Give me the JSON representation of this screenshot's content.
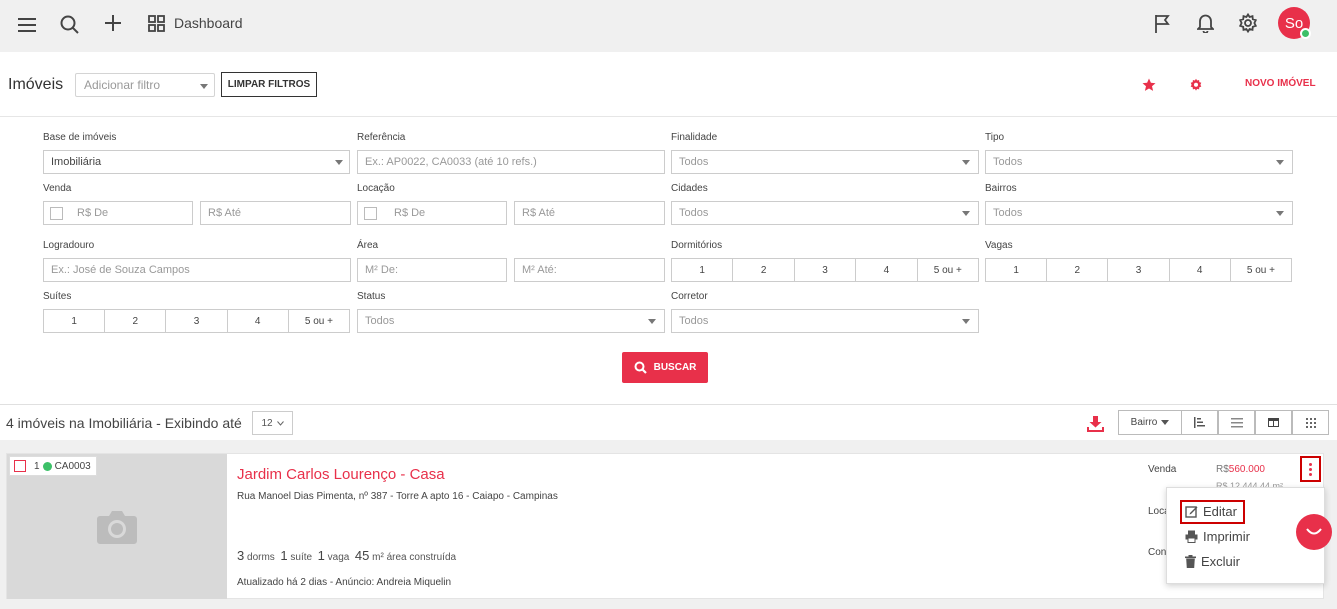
{
  "topbar": {
    "dashboard_label": "Dashboard",
    "avatar_initials": "So",
    "icons": [
      "menu-icon",
      "search-icon",
      "plus-icon",
      "dashboard-grid-icon",
      "flag-icon",
      "bell-icon",
      "gear-icon"
    ]
  },
  "header": {
    "title": "Imóveis",
    "filter_placeholder": "Adicionar filtro",
    "clear_filters": "LIMPAR FILTROS",
    "new_property": "NOVO IMÓVEL"
  },
  "filters": {
    "base": {
      "label": "Base de imóveis",
      "value": "Imobiliária"
    },
    "referencia": {
      "label": "Referência",
      "placeholder": "Ex.: AP0022, CA0033 (até 10 refs.)"
    },
    "finalidade": {
      "label": "Finalidade",
      "value": "Todos"
    },
    "tipo": {
      "label": "Tipo",
      "value": "Todos"
    },
    "venda": {
      "label": "Venda",
      "from": "R$ De",
      "to": "R$ Até"
    },
    "locacao": {
      "label": "Locação",
      "from": "R$ De",
      "to": "R$ Até"
    },
    "cidades": {
      "label": "Cidades",
      "value": "Todos"
    },
    "bairros": {
      "label": "Bairros",
      "value": "Todos"
    },
    "logradouro": {
      "label": "Logradouro",
      "placeholder": "Ex.: José de Souza Campos"
    },
    "area": {
      "label": "Área",
      "from": "M² De:",
      "to": "M² Até:"
    },
    "dormitorios": {
      "label": "Dormitórios",
      "options": [
        "1",
        "2",
        "3",
        "4",
        "5 ou +"
      ]
    },
    "vagas": {
      "label": "Vagas",
      "options": [
        "1",
        "2",
        "3",
        "4",
        "5 ou +"
      ]
    },
    "suites": {
      "label": "Suítes",
      "options": [
        "1",
        "2",
        "3",
        "4",
        "5 ou +"
      ]
    },
    "status": {
      "label": "Status",
      "value": "Todos"
    },
    "corretor": {
      "label": "Corretor",
      "value": "Todos"
    },
    "search_button": "BUSCAR"
  },
  "results": {
    "count_text": "4 imóveis na Imobiliária - Exibindo até",
    "per_page": "12",
    "sort_label": "Bairro"
  },
  "property": {
    "index": "1",
    "code": "CA0003",
    "title": "Jardim Carlos Lourenço - Casa",
    "address": "Rua Manoel Dias Pimenta, nº 387 - Torre A apto 16 - Caiapo - Campinas",
    "dorms_n": "3",
    "dorms_l": "dorms",
    "suites_n": "1",
    "suites_l": "suíte",
    "vagas_n": "1",
    "vagas_l": "vaga",
    "area_n": "45",
    "area_l": "m² área construída",
    "updated": "Atualizado há 2 dias - Anúncio: Andreia Miquelin",
    "sale_label": "Venda",
    "sale_currency": "R$",
    "sale_value": "560.000",
    "sale_sub": "R$ 12.444,44 m²",
    "rent_label": "Loca",
    "cond_label": "Con"
  },
  "menu": {
    "edit": "Editar",
    "print": "Imprimir",
    "delete": "Excluir"
  },
  "colors": {
    "accent": "#e8304a",
    "online": "#3cc068",
    "highlight": "#cc0000"
  }
}
